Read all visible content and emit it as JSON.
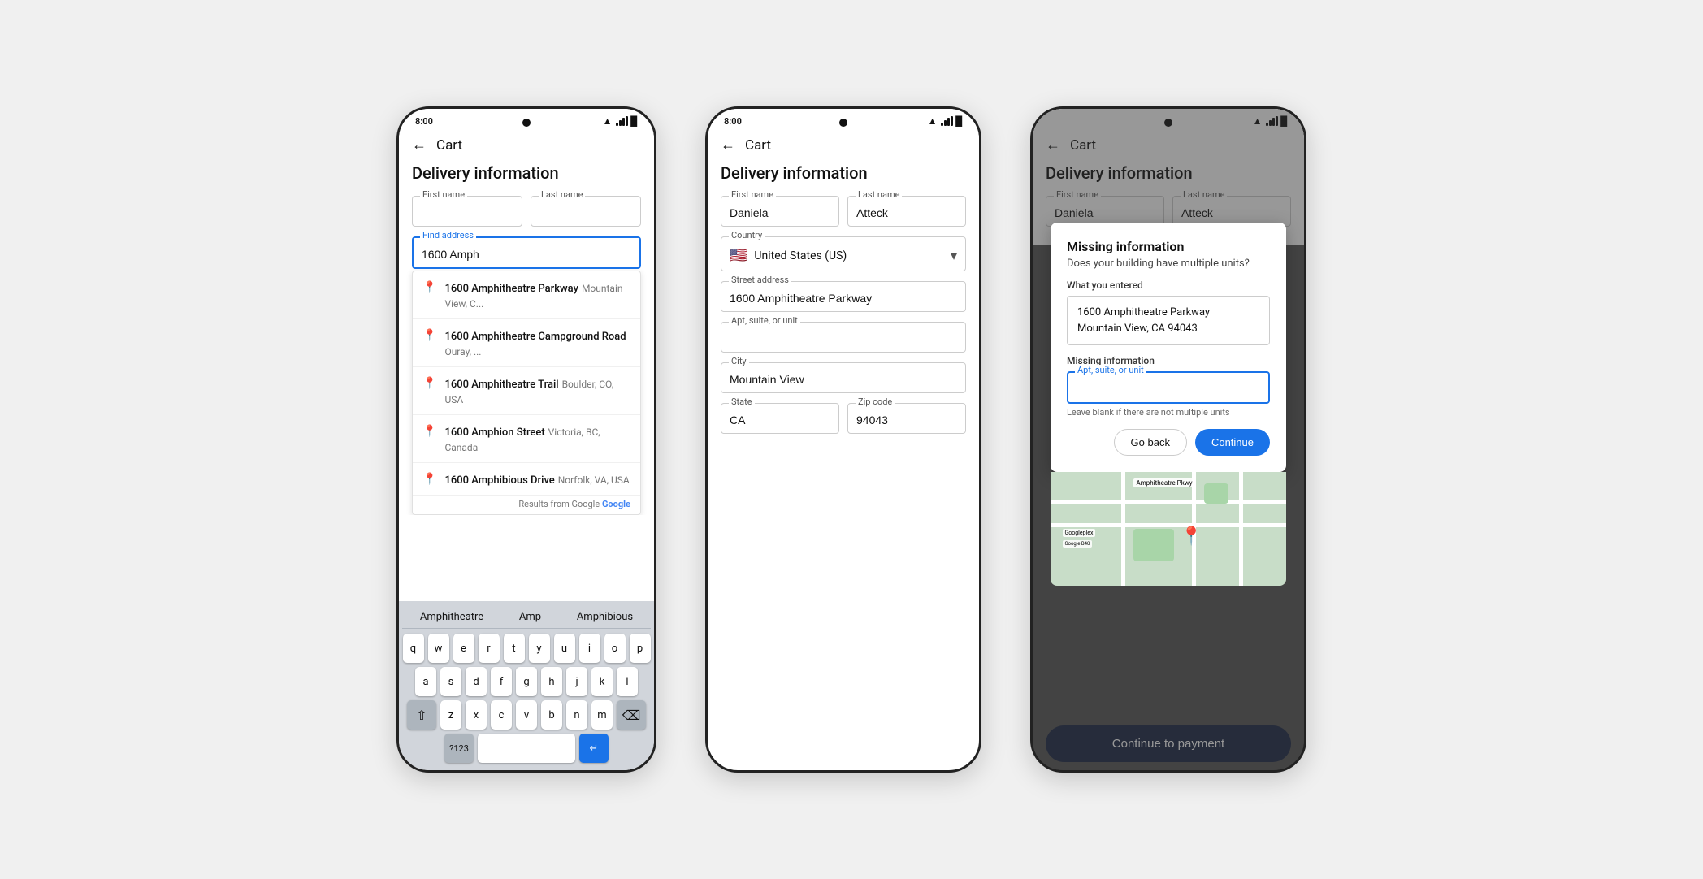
{
  "phone1": {
    "status": {
      "time": "8:00"
    },
    "nav": {
      "back": "←",
      "title": "Cart"
    },
    "page_title": "Delivery information",
    "fields": {
      "first_name": {
        "label": "First name",
        "value": ""
      },
      "last_name": {
        "label": "Last name",
        "value": ""
      },
      "find_address": {
        "label": "Find address",
        "value": "1600 Amph"
      }
    },
    "autocomplete": [
      {
        "main": "1600 Amphitheatre Parkway",
        "sub": "Mountain View, C..."
      },
      {
        "main": "1600 Amphitheatre Campground Road",
        "sub": "Ouray, ..."
      },
      {
        "main": "1600 Amphitheatre Trail",
        "sub": "Boulder, CO, USA"
      },
      {
        "main": "1600 Amphion Street",
        "sub": "Victoria, BC, Canada"
      },
      {
        "main": "1600 Amphibious Drive",
        "sub": "Norfolk, VA, USA"
      }
    ],
    "google_attr": "Results from Google",
    "keyboard": {
      "suggestions": [
        "Amphitheatre",
        "Amp",
        "Amphibious"
      ],
      "rows": [
        [
          "q",
          "w",
          "e",
          "r",
          "t",
          "y",
          "u",
          "i",
          "o",
          "p"
        ],
        [
          "a",
          "s",
          "d",
          "f",
          "g",
          "h",
          "j",
          "k",
          "l"
        ],
        [
          "⇧",
          "z",
          "x",
          "c",
          "v",
          "b",
          "n",
          "m",
          "⌫"
        ]
      ],
      "bottom": [
        "?123",
        " ",
        "↵"
      ]
    }
  },
  "phone2": {
    "status": {
      "time": "8:00"
    },
    "nav": {
      "back": "←",
      "title": "Cart"
    },
    "page_title": "Delivery information",
    "fields": {
      "first_name": {
        "label": "First name",
        "value": "Daniela"
      },
      "last_name": {
        "label": "Last name",
        "value": "Atteck"
      },
      "country": {
        "label": "Country",
        "value": "United States (US)",
        "flag": "🇺🇸"
      },
      "street": {
        "label": "Street address",
        "value": "1600 Amphitheatre Parkway"
      },
      "apt": {
        "label": "Apt, suite, or unit",
        "value": ""
      },
      "city": {
        "label": "City",
        "value": "Mountain View"
      },
      "state": {
        "label": "State",
        "value": "CA"
      },
      "zip": {
        "label": "Zip code",
        "value": "94043"
      }
    }
  },
  "phone3": {
    "status": {
      "time": ""
    },
    "nav": {
      "back": "←",
      "title": "Cart"
    },
    "page_title": "Delivery information",
    "fields": {
      "first_name": {
        "label": "First name",
        "value": "Daniela"
      },
      "last_name": {
        "label": "Last name",
        "value": "Atteck"
      }
    },
    "dialog": {
      "title": "Missing information",
      "subtitle": "Does your building have multiple units?",
      "what_entered_label": "What you entered",
      "address_line1": "1600 Amphitheatre Parkway",
      "address_line2": "Mountain View, CA 94043",
      "missing_label": "Missing information",
      "apt_label": "Apt, suite, or unit",
      "hint": "Leave blank if there are not multiple units",
      "go_back": "Go back",
      "continue": "Continue"
    },
    "continue_payment": "Continue to payment"
  }
}
